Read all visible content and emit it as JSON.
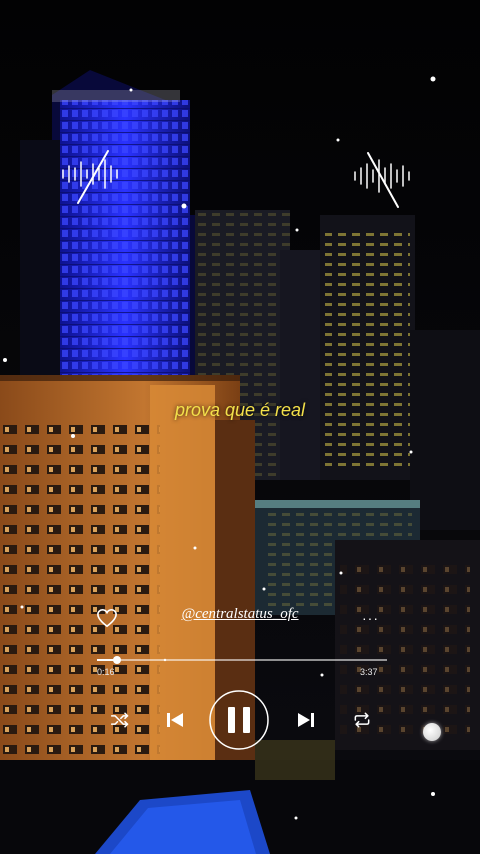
{
  "lyric": {
    "text": "prova que é real"
  },
  "track": {
    "handle": "@centralstatus_ofc",
    "elapsed": "0:16",
    "total": "3:37",
    "progress": 0.07
  },
  "icons": {
    "like": "heart-icon",
    "more": "more-horizontal-icon",
    "shuffle": "shuffle-icon",
    "previous": "skip-previous-icon",
    "play_pause": "pause-icon",
    "next": "skip-next-icon",
    "repeat": "repeat-icon",
    "sound_wave_left": "sound-wave-icon",
    "sound_wave_right": "sound-wave-icon"
  },
  "colors": {
    "lyric": "#f3e04a",
    "controls": "#ffffff",
    "background": "#050507",
    "building_blue": "#1a24d6",
    "building_orange": "#c9782b"
  },
  "more_label": "···"
}
